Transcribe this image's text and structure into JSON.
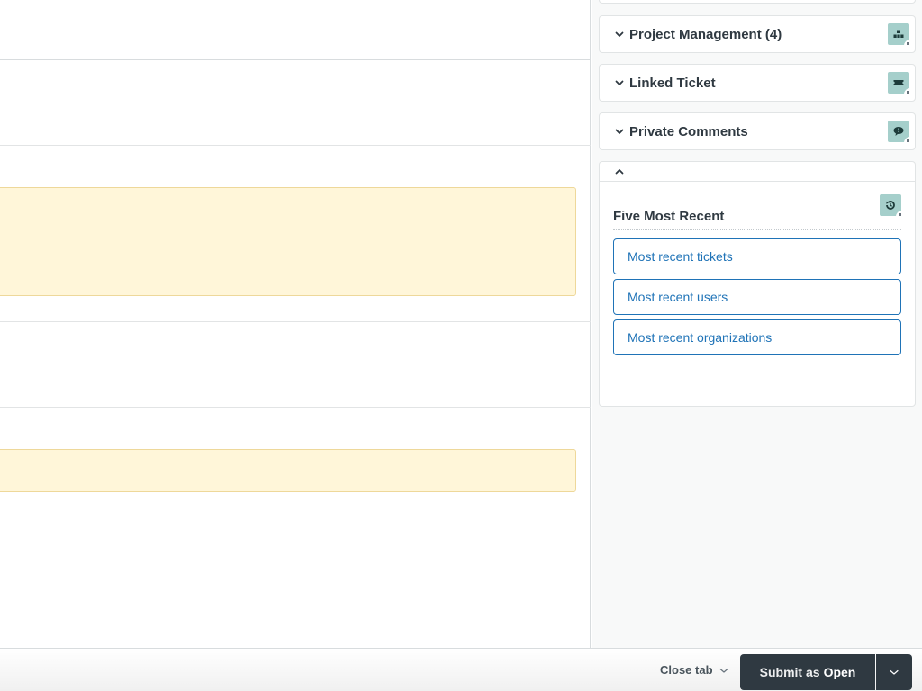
{
  "sidebar": {
    "cards": [
      {
        "title": "Project Management (4)",
        "icon": "hierarchy-icon"
      },
      {
        "title": "Linked Ticket",
        "icon": "ticket-icon"
      },
      {
        "title": "Private Comments",
        "icon": "comment-icon"
      }
    ],
    "recent": {
      "title": "Five Most Recent",
      "icon": "history-icon",
      "buttons": [
        {
          "label": "Most recent tickets"
        },
        {
          "label": "Most recent users"
        },
        {
          "label": "Most recent organizations"
        }
      ]
    }
  },
  "footer": {
    "close_tab_label": "Close tab",
    "submit_prefix": "Submit as",
    "submit_status": "Open"
  },
  "colors": {
    "accent_blue": "#1f73b7",
    "dark_button": "#2f3941",
    "note_bg": "#fff6d9",
    "app_icon_bg": "#a5cfcb"
  }
}
